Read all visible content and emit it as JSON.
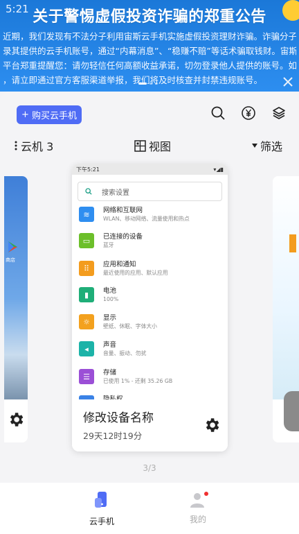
{
  "banner": {
    "status_time": "5:21",
    "title": "关于警惕虚假投资诈骗的郑重公告",
    "lines": [
      "近期，我们发现有不法分子利用宙斯云手机实施虚假投资理财诈骗。诈骗分子诱导",
      "录其提供的云手机账号，通过“内幕消息”、“稳赚不赔”等话术骗取钱财。宙斯",
      "平台郑重提醒您：请勿轻信任何高额收益承诺，切勿登录他人提供的账号。如遇可",
      "，请立即通过官方客服渠道举报，我们将及时核查并封禁违规账号。"
    ]
  },
  "header": {
    "buy_button_label": "购买云手机",
    "icons": [
      "search-icon",
      "yuan-icon",
      "layers-icon"
    ]
  },
  "toolbar": {
    "group_label": "云机 3",
    "view_label": "视图",
    "filter_label": "筛选"
  },
  "device_card": {
    "screen": {
      "status_time": "下午5:21",
      "search_placeholder": "搜索设置",
      "settings": [
        {
          "title": "网络和互联网",
          "subtitle": "WLAN、移动网络、流量使用和热点",
          "color": "#2f8ef0",
          "icon": "wifi-icon"
        },
        {
          "title": "已连接的设备",
          "subtitle": "蓝牙",
          "color": "#6cbf2a",
          "icon": "devices-icon"
        },
        {
          "title": "应用和通知",
          "subtitle": "最近使用的应用、默认应用",
          "color": "#f39c1e",
          "icon": "apps-icon"
        },
        {
          "title": "电池",
          "subtitle": "100%",
          "color": "#1fae78",
          "icon": "battery-icon"
        },
        {
          "title": "显示",
          "subtitle": "壁纸、休眠、字体大小",
          "color": "#f3a11e",
          "icon": "display-icon"
        },
        {
          "title": "声音",
          "subtitle": "音量、振动、勿扰",
          "color": "#1cb3a8",
          "icon": "sound-icon"
        },
        {
          "title": "存储",
          "subtitle": "已使用 1% - 还剩 35.26 GB",
          "color": "#9b4fd6",
          "icon": "storage-icon"
        },
        {
          "title": "隐私权",
          "subtitle": "",
          "color": "#3a82e6",
          "icon": "privacy-icon"
        }
      ]
    },
    "name": "修改设备名称",
    "remaining_time": "29天12时19分"
  },
  "left_card": {
    "app_label": "商店"
  },
  "pager": {
    "text": "3/3"
  },
  "bottom_nav": {
    "items": [
      {
        "label": "云手机",
        "icon": "cloud-phone-icon",
        "active": true
      },
      {
        "label": "我的",
        "icon": "profile-icon",
        "active": false
      }
    ]
  },
  "colors": {
    "accent": "#4f6cf5",
    "banner": "#2d8ef0"
  }
}
